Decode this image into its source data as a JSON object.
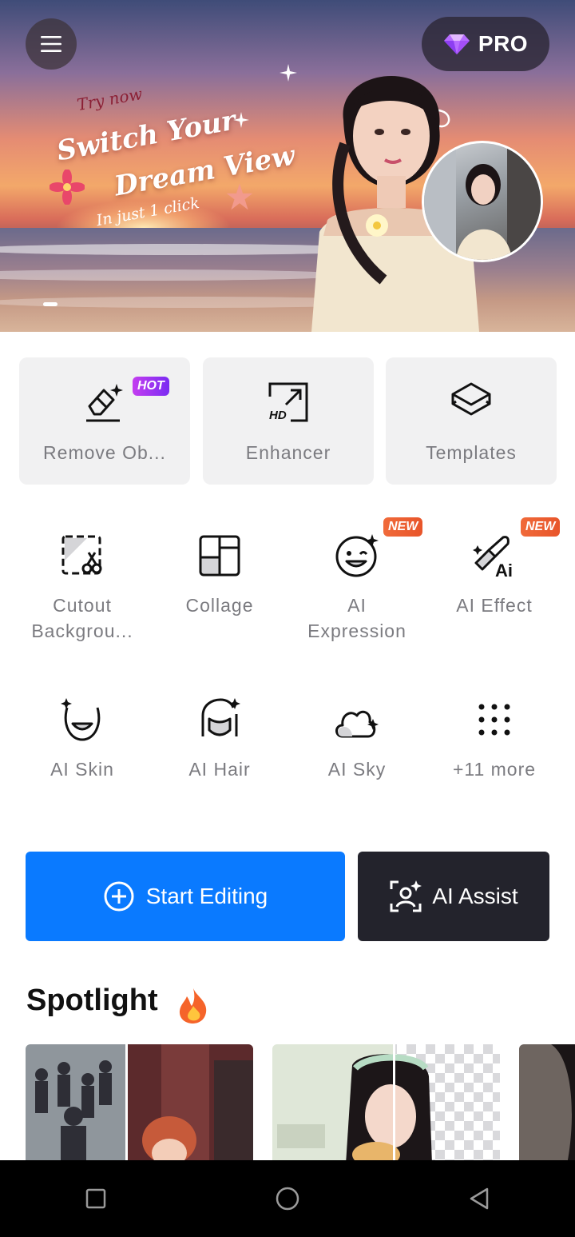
{
  "hero": {
    "tagline_top": "Try now",
    "headline_line1": "Switch Your",
    "headline_line2": "Dream View",
    "tagline_bottom": "In just 1 click",
    "pro_label": "PRO"
  },
  "feature_cards": [
    {
      "label": "Remove Ob...",
      "icon": "eraser-icon",
      "badge": "HOT"
    },
    {
      "label": "Enhancer",
      "icon": "hd-enhance-icon",
      "badge": ""
    },
    {
      "label": "Templates",
      "icon": "layers-icon",
      "badge": ""
    }
  ],
  "tools_row1": [
    {
      "label": "Cutout\nBackgrou...",
      "icon": "cutout-scissors-icon",
      "badge": ""
    },
    {
      "label": "Collage",
      "icon": "collage-icon",
      "badge": ""
    },
    {
      "label": "AI\nExpression",
      "icon": "wink-face-icon",
      "badge": "NEW"
    },
    {
      "label": "AI Effect",
      "icon": "ai-brush-icon",
      "badge": "NEW"
    }
  ],
  "tools_row2": [
    {
      "label": "AI Skin",
      "icon": "face-skin-icon"
    },
    {
      "label": "AI Hair",
      "icon": "hair-icon"
    },
    {
      "label": "AI Sky",
      "icon": "cloud-sparkle-icon"
    },
    {
      "label": "+11 more",
      "icon": "dots-grid-icon"
    }
  ],
  "actions": {
    "start_editing": "Start Editing",
    "ai_assist": "AI Assist"
  },
  "spotlight": {
    "title": "Spotlight",
    "emoji": "🔥"
  },
  "colors": {
    "primary_blue": "#0a7aff",
    "dark_button": "#23232c",
    "hot_badge": "#a833f2",
    "new_badge": "#ee6133"
  }
}
